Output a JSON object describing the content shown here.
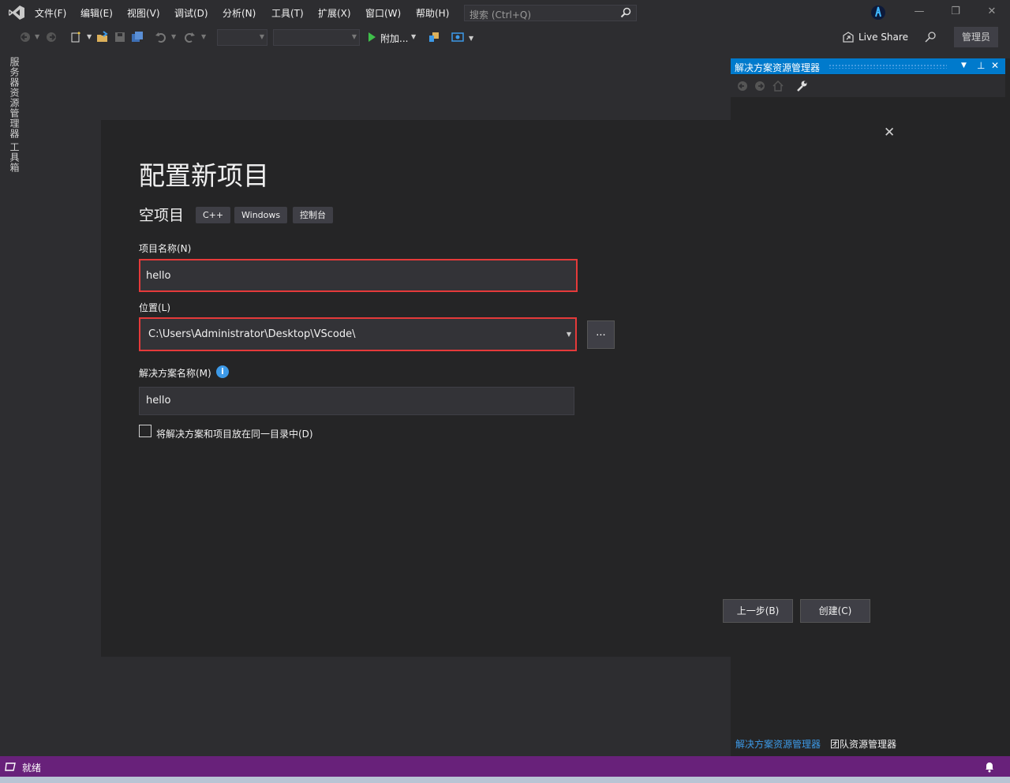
{
  "menu": {
    "items": [
      "文件(F)",
      "编辑(E)",
      "视图(V)",
      "调试(D)",
      "分析(N)",
      "工具(T)",
      "扩展(X)",
      "窗口(W)",
      "帮助(H)"
    ],
    "search_placeholder": "搜索 (Ctrl+Q)"
  },
  "toolbar": {
    "attach_label": "附加...",
    "liveshare_label": "Live Share",
    "admin_label": "管理员"
  },
  "left_tabs": {
    "server_explorer": "服务器资源管理器",
    "toolbox": "工具箱"
  },
  "solution_explorer": {
    "title": "解决方案资源管理器",
    "tab_solution": "解决方案资源管理器",
    "tab_team": "团队资源管理器"
  },
  "dialog": {
    "title": "配置新项目",
    "template_name": "空项目",
    "tags": [
      "C++",
      "Windows",
      "控制台"
    ],
    "project_name_label": "项目名称(N)",
    "project_name_value": "hello",
    "location_label": "位置(L)",
    "location_value": "C:\\Users\\Administrator\\Desktop\\VScode\\",
    "browse_label": "...",
    "solution_name_label": "解决方案名称(M)",
    "solution_name_value": "hello",
    "same_dir_label": "将解决方案和项目放在同一目录中(D)",
    "same_dir_checked": false,
    "back_label": "上一步(B)",
    "create_label": "创建(C)"
  },
  "status": {
    "text": "就绪",
    "color": "#68217a"
  },
  "colors": {
    "accent": "#007acc",
    "highlight": "#e53a3a",
    "info": "#3d9ae8"
  }
}
